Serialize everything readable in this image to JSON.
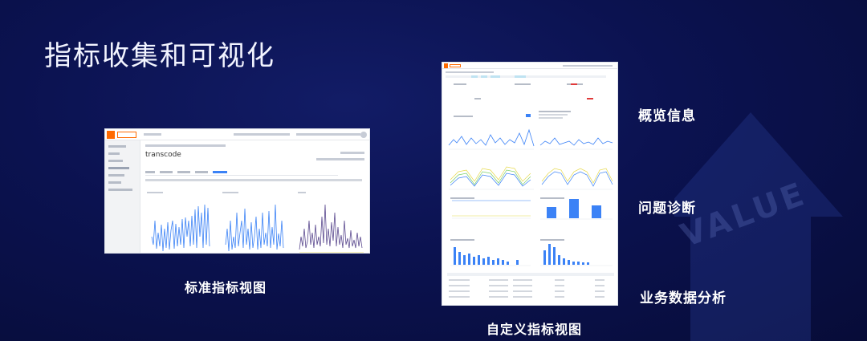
{
  "slide": {
    "title": "指标收集和可视化",
    "watermark": "VALUE"
  },
  "left_panel": {
    "caption": "标准指标视图",
    "page_title": "transcode"
  },
  "right_panel": {
    "caption": "自定义指标视图",
    "labels": [
      "概览信息",
      "问题诊断",
      "业务数据分析"
    ]
  },
  "colors": {
    "background": "#0b1250",
    "accent_orange": "#ff6a00",
    "chart_blue": "#3b82f6",
    "chart_purple": "#5b4a8f",
    "chart_yellow": "#e6d94a",
    "chart_green": "#7ccf6a"
  }
}
